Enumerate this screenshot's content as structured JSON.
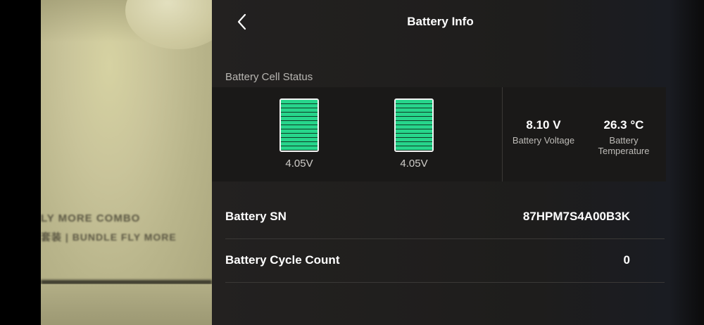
{
  "header": {
    "title": "Battery Info",
    "back_icon": "chevron-left-icon"
  },
  "camera_feed": {
    "text_line_1": "LY MORE COMBO",
    "text_line_2": "套装 | BUNDLE FLY MORE"
  },
  "cell_status": {
    "label": "Battery Cell Status",
    "cells": [
      {
        "voltage": "4.05V",
        "charge_percent": 100
      },
      {
        "voltage": "4.05V",
        "charge_percent": 100
      }
    ],
    "voltage": {
      "value": "8.10 V",
      "label": "Battery Voltage"
    },
    "temperature": {
      "value": "26.3 °C",
      "label": "Battery Temperature"
    }
  },
  "details": [
    {
      "label": "Battery SN",
      "value": "87HPM7S4A00B3K"
    },
    {
      "label": "Battery Cycle Count",
      "value": "0"
    }
  ],
  "colors": {
    "cell_fill": "#27d58b",
    "panel_bg": "#1e1d1c"
  }
}
